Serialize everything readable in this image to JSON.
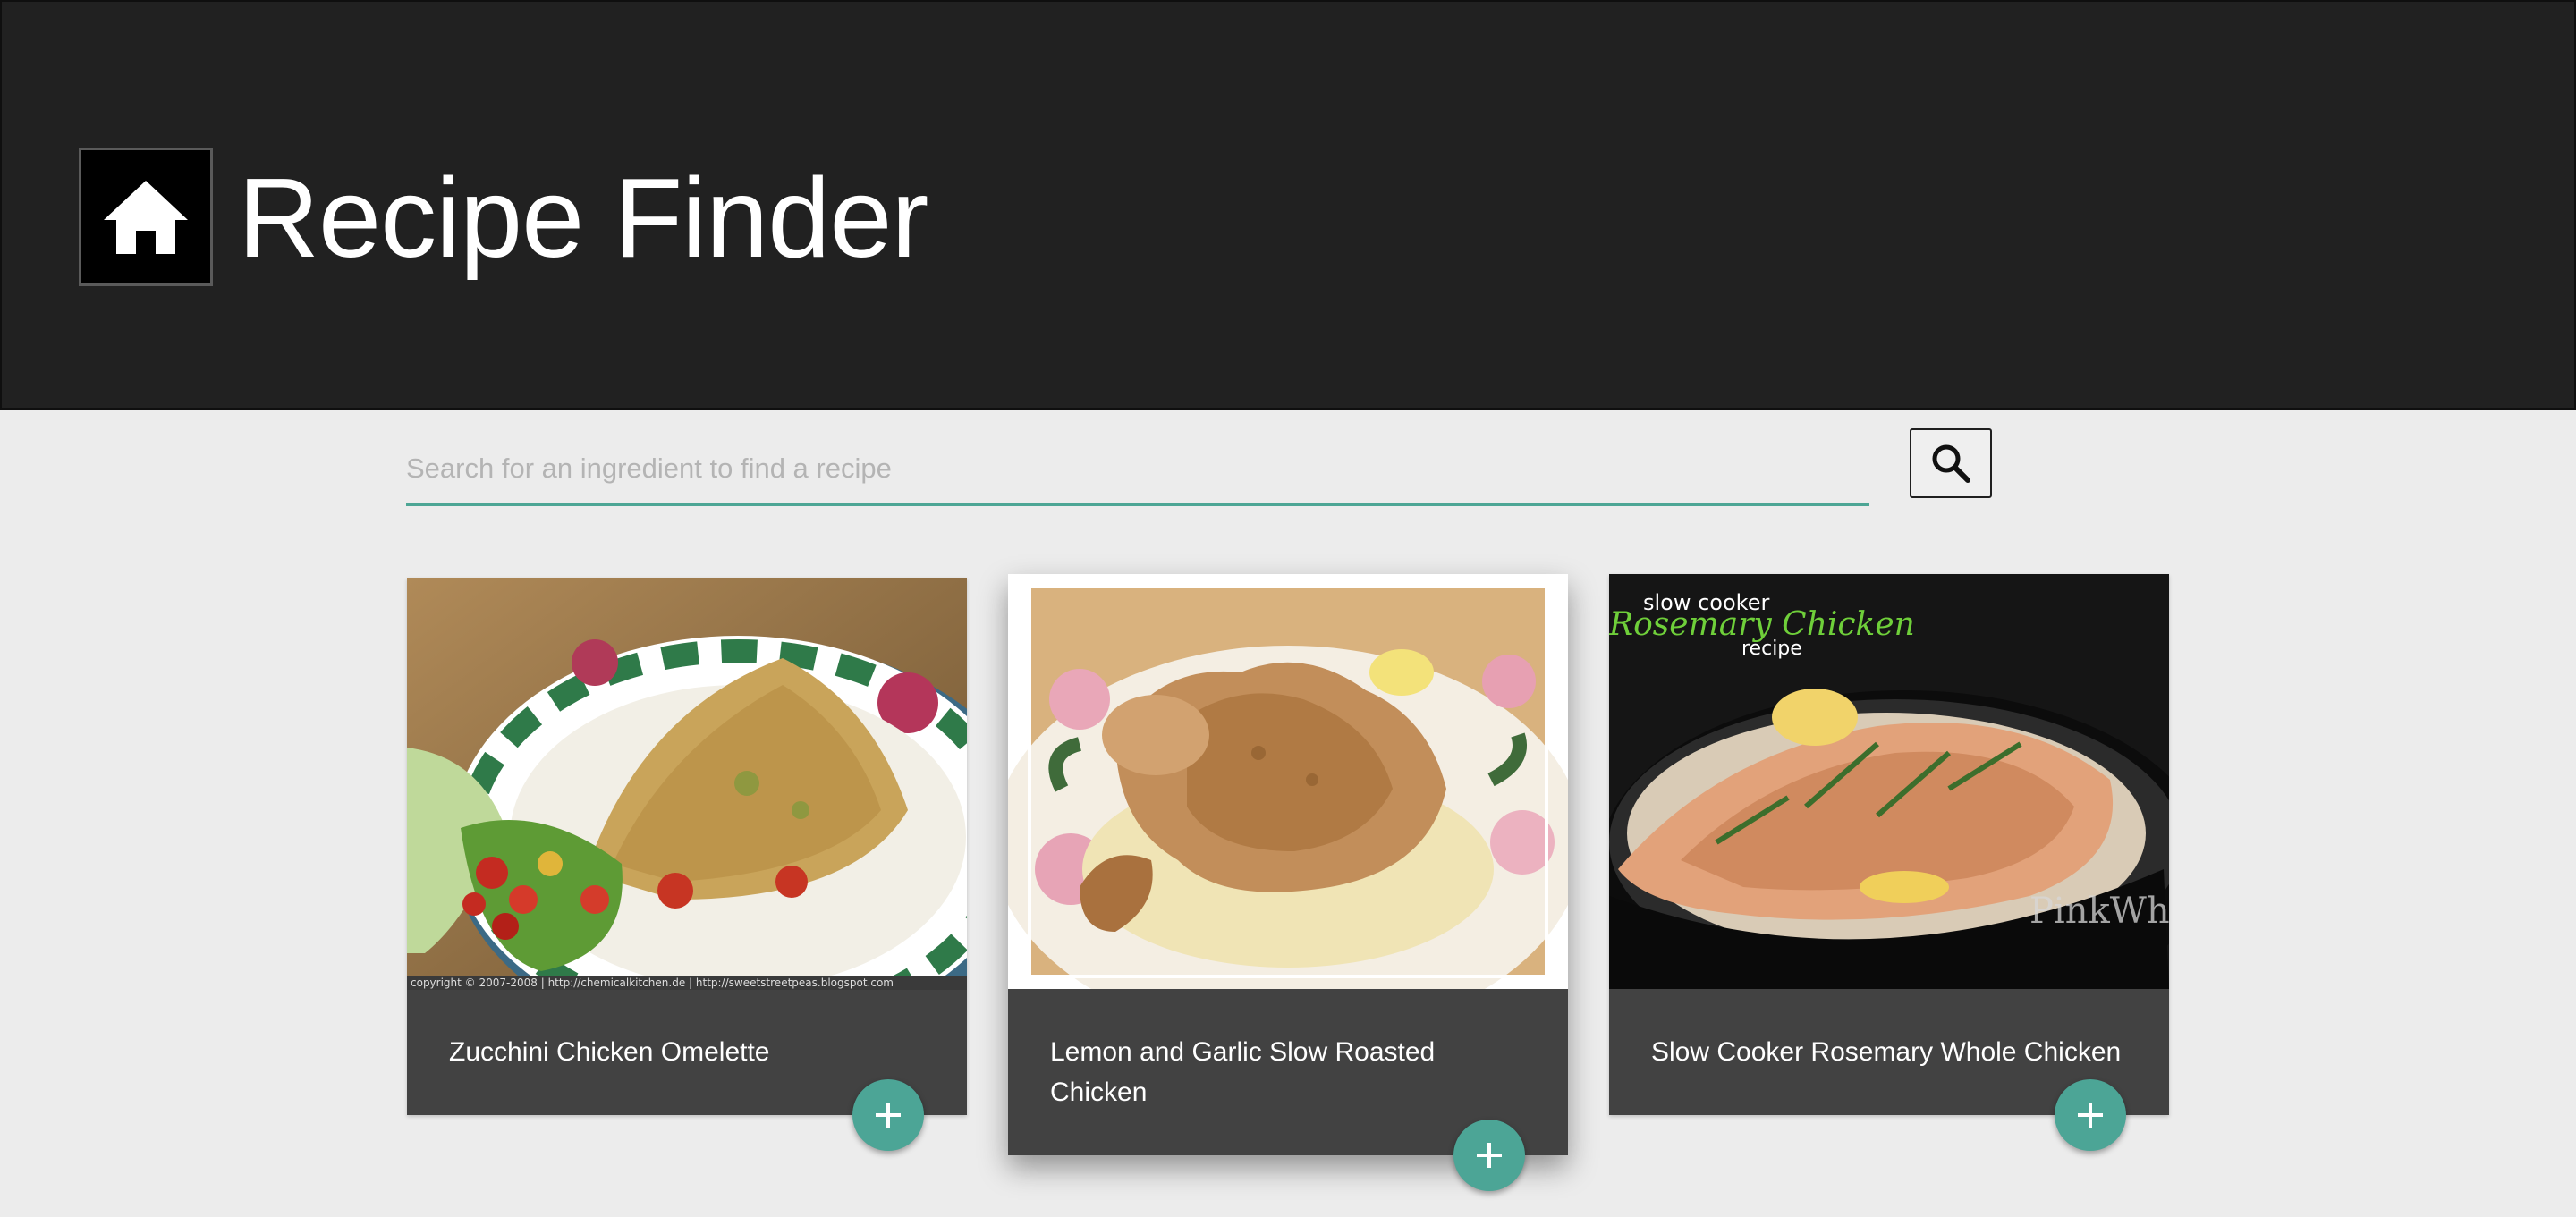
{
  "header": {
    "title": "Recipe Finder",
    "home_icon": "home-icon",
    "background": "#212121"
  },
  "search": {
    "placeholder": "Search for an ingredient to find a recipe",
    "value": "",
    "button_icon": "search-icon",
    "accent": "#4da695"
  },
  "recipes": [
    {
      "title": "Zucchini Chicken Omelette",
      "add_icon": "plus-icon"
    },
    {
      "title": "Lemon and Garlic Slow Roasted Chicken",
      "add_icon": "plus-icon"
    },
    {
      "title": "Slow Cooker Rosemary Whole Chicken",
      "add_icon": "plus-icon"
    }
  ],
  "photo_text": {
    "photo1_footer": "copyright © 2007-2008 | http://chemicalkitchen.de | http://sweetstreetpeas.blogspot.com",
    "photo3_line1": "slow cooker",
    "photo3_line2": "Rosemary Chicken",
    "photo3_line3": "recipe",
    "photo3_watermark": "PinkWh"
  },
  "colors": {
    "page_bg": "#ececec",
    "card_bg": "#424242",
    "fab": "#4ca596"
  }
}
